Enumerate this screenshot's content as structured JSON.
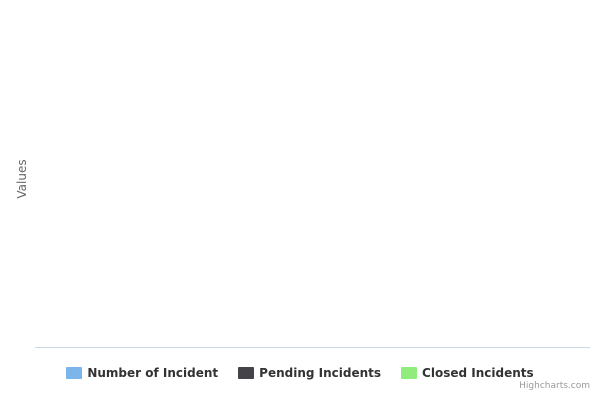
{
  "chart_data": {
    "type": "bar",
    "categories": [],
    "series": [
      {
        "name": "Number of Incident",
        "color": "#7cb5ec",
        "values": []
      },
      {
        "name": "Pending Incidents",
        "color": "#434348",
        "values": []
      },
      {
        "name": "Closed Incidents",
        "color": "#90ed7d",
        "values": []
      }
    ],
    "title": "",
    "xlabel": "",
    "ylabel": "Values",
    "grid": false,
    "legend": "bottom-center"
  },
  "credits": {
    "label": "Highcharts.com"
  },
  "colors": {
    "axis_line": "#ccd6eb",
    "axis_title": "#666666",
    "legend_text": "#333333",
    "credits_text": "#999999"
  }
}
